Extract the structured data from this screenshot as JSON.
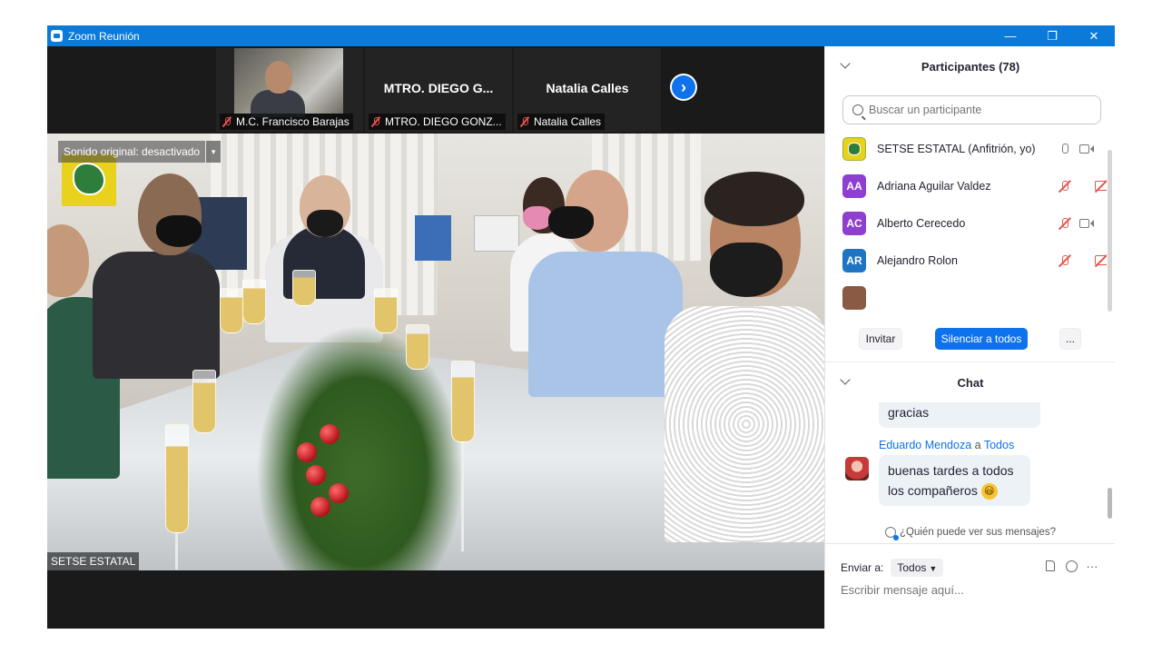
{
  "window": {
    "title": "Zoom Reunión",
    "controls": {
      "minimize": "—",
      "restore": "❐",
      "close": "✕"
    }
  },
  "thumbnails": [
    {
      "label": "M.C. Francisco Barajas",
      "has_video": true,
      "display_name": ""
    },
    {
      "label": "MTRO. DIEGO GONZ...",
      "has_video": false,
      "display_name": "MTRO. DIEGO G..."
    },
    {
      "label": "Natalia Calles",
      "has_video": false,
      "display_name": "Natalia Calles"
    }
  ],
  "next_button": {
    "glyph": "›"
  },
  "main_video": {
    "original_sound": "Sonido original: desactivado",
    "dropdown_glyph": "▾",
    "speaker_label": "SETSE ESTATAL"
  },
  "participants": {
    "title": "Participantes (78)",
    "search_placeholder": "Buscar un participante",
    "list": [
      {
        "initials": "",
        "name": "SETSE ESTATAL (Anfitrión, yo)",
        "color": "#e8d21b",
        "mic": "on",
        "cam": "on"
      },
      {
        "initials": "AA",
        "name": "Adriana Aguilar Valdez",
        "color": "#8e3fd0",
        "mic": "off",
        "cam": "off"
      },
      {
        "initials": "AC",
        "name": "Alberto Cerecedo",
        "color": "#8e3fd0",
        "mic": "off",
        "cam": "on"
      },
      {
        "initials": "AR",
        "name": "Alejandro Rolon",
        "color": "#1f74c4",
        "mic": "off",
        "cam": "off"
      }
    ],
    "buttons": {
      "invite": "Invitar",
      "mute_all": "Silenciar a todos",
      "more": "..."
    }
  },
  "chat": {
    "title": "Chat",
    "messages": [
      {
        "sender": "",
        "to": "",
        "text": "gracias"
      },
      {
        "sender": "Eduardo Mendoza",
        "to": "Todos",
        "connector": "a",
        "line1": "buenas tardes a todos",
        "line2": "los compañeros",
        "emoji": "😃"
      }
    ],
    "who_can_see": "¿Quién puede ver sus mensajes?",
    "send_to_label": "Enviar a:",
    "send_to_value": "Todos",
    "input_placeholder": "Escribir mensaje aquí...",
    "footer_icons": [
      "file-icon",
      "emoji-icon",
      "more-icon"
    ]
  },
  "colors": {
    "titlebar": "#0b7ad9",
    "accent": "#0e72ed",
    "muted_red": "#e5544a"
  }
}
